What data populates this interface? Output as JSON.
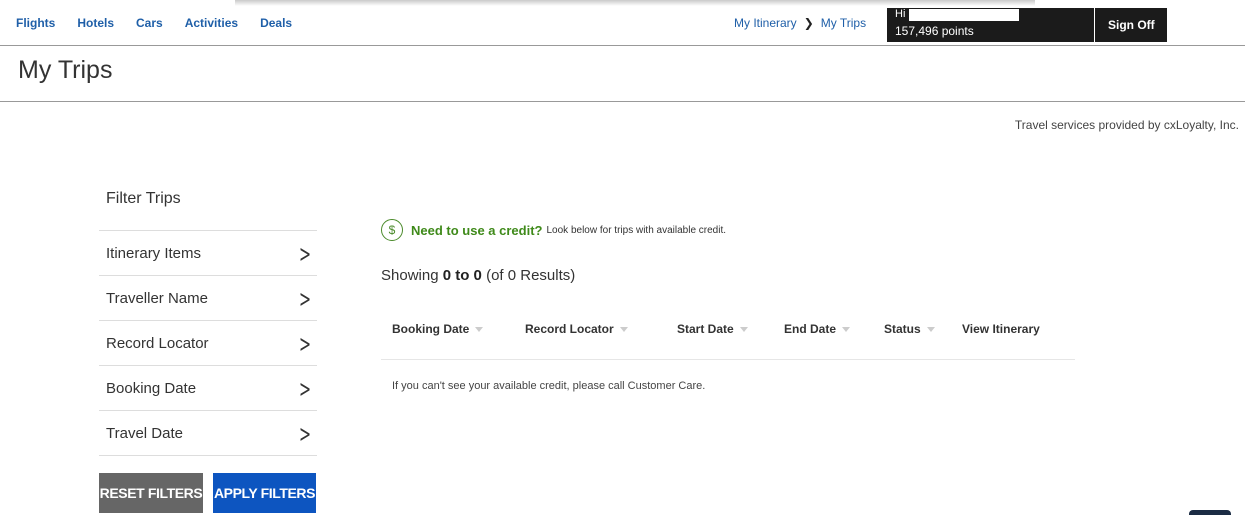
{
  "nav": {
    "items": [
      {
        "label": "Flights"
      },
      {
        "label": "Hotels"
      },
      {
        "label": "Cars"
      },
      {
        "label": "Activities"
      },
      {
        "label": "Deals"
      }
    ]
  },
  "breadcrumb": {
    "items": [
      {
        "label": "My Itinerary"
      },
      {
        "label": "My Trips"
      }
    ]
  },
  "user": {
    "greeting": "Hi",
    "points": "157,496 points",
    "sign_off_label": "Sign Off"
  },
  "page": {
    "title": "My Trips",
    "provider_text": "Travel services provided by cxLoyalty, Inc."
  },
  "filters": {
    "title": "Filter Trips",
    "items": [
      {
        "label": "Itinerary Items"
      },
      {
        "label": "Traveller Name"
      },
      {
        "label": "Record Locator"
      },
      {
        "label": "Booking Date"
      },
      {
        "label": "Travel Date"
      }
    ],
    "reset_label": "RESET FILTERS",
    "apply_label": "APPLY FILTERS"
  },
  "credit_note": {
    "icon": "dollar-icon",
    "headline": "Need to use a credit?",
    "subtext": "Look below for trips with available credit."
  },
  "results": {
    "prefix": "Showing",
    "range": "0 to 0",
    "suffix": "(of 0 Results)"
  },
  "table": {
    "columns": [
      {
        "label": "Booking Date",
        "sortable": true
      },
      {
        "label": "Record Locator",
        "sortable": true
      },
      {
        "label": "Start Date",
        "sortable": true
      },
      {
        "label": "End Date",
        "sortable": true
      },
      {
        "label": "Status",
        "sortable": true
      },
      {
        "label": "View Itinerary",
        "sortable": false
      }
    ],
    "empty_message": "If you can't see your available credit, please call Customer Care."
  },
  "colors": {
    "link": "#1f5fa8",
    "dark_panel": "#1b1b1b",
    "credit_green": "#3f8a1a",
    "apply_blue": "#0d55c0",
    "reset_gray": "#666666"
  }
}
